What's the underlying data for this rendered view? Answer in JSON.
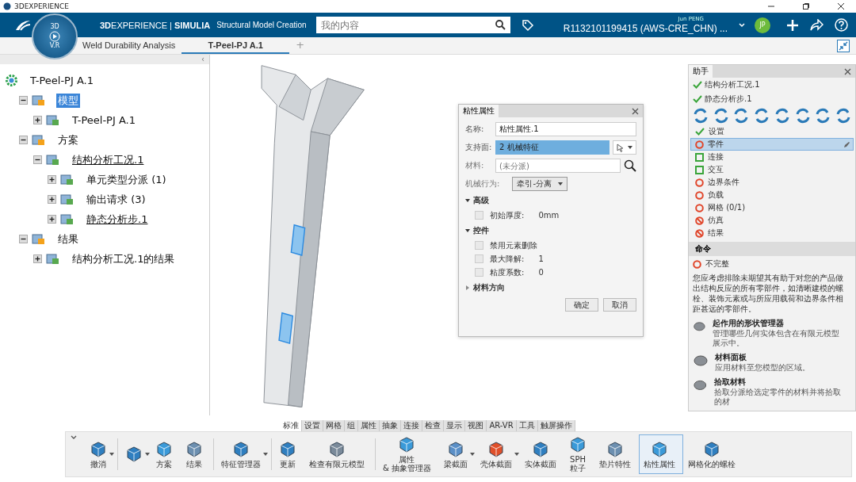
{
  "window": {
    "title": "3DEXPERIENCE"
  },
  "topbar": {
    "brand": "**3D**EXPERIENCE | **SIMULIA**",
    "app_title": "Structural Model Creation",
    "search": {
      "placeholder": "我的内容"
    },
    "user": "Jun PENG",
    "avatar": "JP",
    "tenant": "R1132101199415 (AWS-CRE_CHN) ..."
  },
  "compass": {
    "top": "3D",
    "bottom": "V.R"
  },
  "tabs": [
    {
      "label": "Weld Durability Analysis",
      "selected": false
    },
    {
      "label": "T-Peel-PJ A.1",
      "selected": true
    }
  ],
  "add_tab": "+",
  "tree_collapse": "‹",
  "tree": [
    {
      "label": "T-Peel-PJ A.1",
      "selected": false,
      "current": false,
      "children": [
        {
          "label": "模型",
          "expanded": true,
          "selected": true,
          "current": false,
          "children": [
            {
              "label": "T-Peel-PJ A.1",
              "expanded": false,
              "selected": false,
              "current": false
            }
          ]
        },
        {
          "label": "方案",
          "expanded": true,
          "selected": false,
          "current": false,
          "children": [
            {
              "label": "结构分析工况.1",
              "expanded": true,
              "selected": false,
              "current": true,
              "children": [
                {
                  "label": "单元类型分派 (1)",
                  "expanded": false,
                  "selected": false,
                  "current": false
                },
                {
                  "label": "输出请求 (3)",
                  "expanded": false,
                  "selected": false,
                  "current": false
                },
                {
                  "label": "静态分析步.1",
                  "expanded": false,
                  "selected": false,
                  "current": true
                }
              ]
            }
          ]
        },
        {
          "label": "结果",
          "expanded": true,
          "selected": false,
          "current": false,
          "children": [
            {
              "label": "结构分析工况.1的结果",
              "expanded": false,
              "selected": false,
              "current": false
            }
          ]
        }
      ]
    }
  ],
  "dialog": {
    "title": "粘性属性",
    "name_label": "名称:",
    "name_value": "粘性属性.1",
    "support_label": "支持面:",
    "support_value": "2 机械特征",
    "material_label": "材料:",
    "material_placeholder": "(未分派)",
    "behavior_label": "机械行为:",
    "behavior_value": "牵引-分离",
    "sections": [
      {
        "title": "高级",
        "expanded": true,
        "options": [
          {
            "label": "初始厚度:",
            "value": "0mm",
            "checked": false
          }
        ]
      },
      {
        "title": "控件",
        "expanded": true,
        "options": [
          {
            "label": "禁用元素删除",
            "checked": false
          },
          {
            "label": "最大降解:",
            "value": "1",
            "checked": false
          },
          {
            "label": "粘度系数:",
            "value": "0",
            "checked": false
          }
        ]
      },
      {
        "title": "材料方向",
        "expanded": false
      }
    ],
    "buttons": [
      "确定",
      "取消"
    ]
  },
  "assistant": {
    "title": "助手",
    "done": [
      "结构分析工况.1",
      "静态分析步.1"
    ],
    "steps": [
      {
        "label": "设置",
        "kind": "done",
        "selected": false
      },
      {
        "label": "零件",
        "kind": "todo",
        "selected": true
      },
      {
        "label": "连接",
        "kind": "optional",
        "selected": false
      },
      {
        "label": "交互",
        "kind": "optional",
        "selected": false
      },
      {
        "label": "边界条件",
        "kind": "todo",
        "selected": false
      },
      {
        "label": "负载",
        "kind": "todo",
        "selected": false
      },
      {
        "label": "网格 (0/1)",
        "kind": "todo",
        "selected": false
      },
      {
        "label": "仿真",
        "kind": "blocked",
        "selected": false
      },
      {
        "label": "结果",
        "kind": "blocked",
        "selected": false
      }
    ],
    "commands_title": "命令",
    "status": "不完整",
    "description": "您应考虑排除未期望其有助于对您的产品做出结构反应的所有零部件，如清晰建模的螺栓、装饰元素或与所应用载荷和边界条件相距甚远的零部件。",
    "commands": [
      {
        "title": "起作用的形状管理器",
        "desc": "管理哪些几何实体包含在有限元模型展示中。"
      },
      {
        "title": "材料面板",
        "desc": "应用材料至您模型的区域。"
      },
      {
        "title": "拾取材料",
        "desc": "拾取分派给选定零件的材料并将拾取的材"
      }
    ]
  },
  "bottom_tabs": [
    {
      "label": "标准",
      "selected": true
    },
    {
      "label": "设置",
      "selected": false
    },
    {
      "label": "网格",
      "selected": false
    },
    {
      "label": "组",
      "selected": false
    },
    {
      "label": "属性",
      "selected": false
    },
    {
      "label": "抽象",
      "selected": false
    },
    {
      "label": "连接",
      "selected": false
    },
    {
      "label": "检查",
      "selected": false
    },
    {
      "label": "显示",
      "selected": false
    },
    {
      "label": "视图",
      "selected": false
    },
    {
      "label": "AR-VR",
      "selected": false
    },
    {
      "label": "工具",
      "selected": false
    },
    {
      "label": "触屏操作",
      "selected": false
    }
  ],
  "toolbar": [
    [
      {
        "label": "撤消",
        "dropdown": true,
        "selected": false
      }
    ],
    [
      {
        "dropdown": true,
        "selected": false
      },
      {
        "label": "方案",
        "dropdown": false,
        "selected": false
      },
      {
        "label": "结果",
        "dropdown": false,
        "selected": false
      }
    ],
    [
      {
        "label": "特征管理器",
        "dropdown": true,
        "selected": false
      }
    ],
    [
      {
        "label": "更新",
        "dropdown": false,
        "selected": false
      },
      {
        "label": "检查有限元模型",
        "dropdown": false,
        "selected": false
      }
    ],
    [
      {
        "label": "属性\n& 抽象管理器",
        "dropdown": false,
        "selected": false
      },
      {
        "label": "梁截面",
        "dropdown": true,
        "selected": false
      },
      {
        "label": "壳体截面",
        "dropdown": true,
        "selected": false
      },
      {
        "label": "实体截面",
        "dropdown": false,
        "selected": false
      },
      {
        "label": "SPH\n粒子",
        "dropdown": false,
        "selected": false
      },
      {
        "label": "垫片特性",
        "dropdown": false,
        "selected": false
      },
      {
        "label": "粘性属性",
        "dropdown": false,
        "selected": true
      },
      {
        "label": "网格化的螺栓",
        "dropdown": false,
        "selected": false
      }
    ]
  ]
}
